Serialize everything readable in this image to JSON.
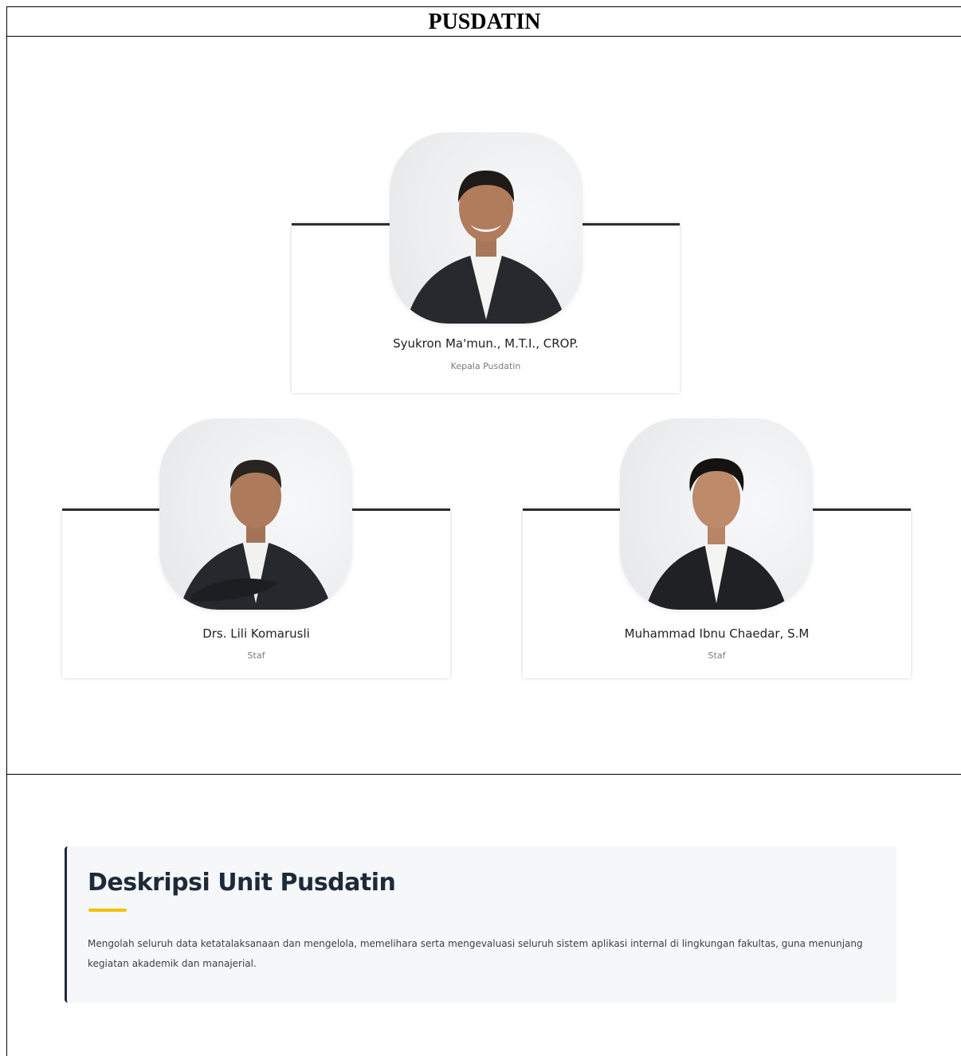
{
  "document": {
    "title": "PUSDATIN"
  },
  "org_chart": {
    "head": {
      "name": "Syukron Ma'mun., M.T.I., CROP.",
      "role": "Kepala Pusdatin"
    },
    "staff": [
      {
        "name": "Drs. Lili Komarusli",
        "role": "Staf"
      },
      {
        "name": "Muhammad Ibnu Chaedar, S.M",
        "role": "Staf"
      }
    ]
  },
  "description": {
    "heading": "Deskripsi Unit Pusdatin",
    "text": "Mengolah seluruh data ketatalaksanaan dan mengelola, memelihara serta mengevaluasi seluruh sistem aplikasi internal di lingkungan fakultas, guna menunjang kegiatan akademik dan manajerial."
  },
  "colors": {
    "heading": "#1d2a3a",
    "accent": "#f2c200",
    "panel_background": "#f6f7f9",
    "card_line": "#2d2d2d"
  }
}
